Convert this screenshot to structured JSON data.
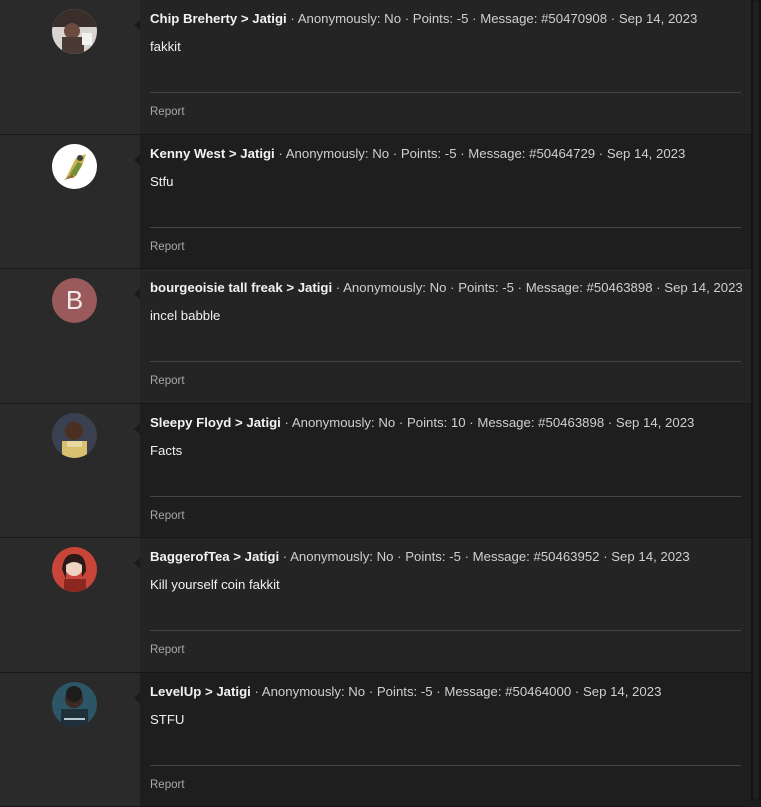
{
  "posts": [
    {
      "author": "Chip Breherty",
      "recipient": "Jatigi",
      "anonymously": "Anonymously: No",
      "points": "Points: -5",
      "message_id": "Message: #50470908",
      "date": "Sep 14, 2023",
      "text": "fakkit",
      "report": "Report",
      "avatar": "photo-avatar-icon"
    },
    {
      "author": "Kenny West",
      "recipient": "Jatigi",
      "anonymously": "Anonymously: No",
      "points": "Points: -5",
      "message_id": "Message: #50464729",
      "date": "Sep 14, 2023",
      "text": "Stfu",
      "report": "Report",
      "avatar": "illustrated-avatar-icon"
    },
    {
      "author": "bourgeoisie tall freak",
      "recipient": "Jatigi",
      "anonymously": "Anonymously: No",
      "points": "Points: -5",
      "message_id": "Message: #50463898",
      "date": "Sep 14, 2023",
      "text": "incel babble",
      "report": "Report",
      "avatar_letter": "B"
    },
    {
      "author": "Sleepy Floyd",
      "recipient": "Jatigi",
      "anonymously": "Anonymously: No",
      "points": "Points: 10",
      "message_id": "Message: #50463898",
      "date": "Sep 14, 2023",
      "text": "Facts",
      "report": "Report",
      "avatar": "photo-avatar-icon"
    },
    {
      "author": "BaggerofTea",
      "recipient": "Jatigi",
      "anonymously": "Anonymously: No",
      "points": "Points: -5",
      "message_id": "Message: #50463952",
      "date": "Sep 14, 2023",
      "text": "Kill yourself coin fakkit",
      "report": "Report",
      "avatar": "photo-avatar-icon"
    },
    {
      "author": "LevelUp",
      "recipient": "Jatigi",
      "anonymously": "Anonymously: No",
      "points": "Points: -5",
      "message_id": "Message: #50464000",
      "date": "Sep 14, 2023",
      "text": "STFU",
      "report": "Report",
      "avatar": "photo-avatar-icon"
    }
  ],
  "colors": {
    "background": "#1c1c1c",
    "gutter": "#2a2a2a",
    "letter_avatar": "#9a5a5c"
  }
}
